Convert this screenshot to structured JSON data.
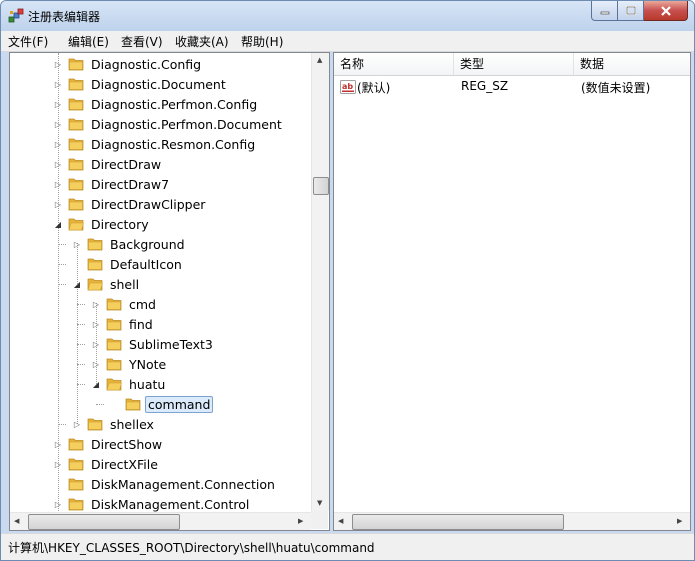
{
  "window": {
    "title": "注册表编辑器"
  },
  "menu": {
    "items": [
      "文件(F)",
      "编辑(E)",
      "查看(V)",
      "收藏夹(A)",
      "帮助(H)"
    ]
  },
  "tree": {
    "rows": [
      {
        "label": "Diagnostic.Config",
        "level": 0,
        "state": "collapsed"
      },
      {
        "label": "Diagnostic.Document",
        "level": 0,
        "state": "collapsed"
      },
      {
        "label": "Diagnostic.Perfmon.Config",
        "level": 0,
        "state": "collapsed"
      },
      {
        "label": "Diagnostic.Perfmon.Document",
        "level": 0,
        "state": "collapsed"
      },
      {
        "label": "Diagnostic.Resmon.Config",
        "level": 0,
        "state": "collapsed"
      },
      {
        "label": "DirectDraw",
        "level": 0,
        "state": "collapsed"
      },
      {
        "label": "DirectDraw7",
        "level": 0,
        "state": "collapsed"
      },
      {
        "label": "DirectDrawClipper",
        "level": 0,
        "state": "collapsed"
      },
      {
        "label": "Directory",
        "level": 0,
        "state": "expanded"
      },
      {
        "label": "Background",
        "level": 1,
        "state": "collapsed"
      },
      {
        "label": "DefaultIcon",
        "level": 1,
        "state": "leaf"
      },
      {
        "label": "shell",
        "level": 1,
        "state": "expanded"
      },
      {
        "label": "cmd",
        "level": 2,
        "state": "collapsed"
      },
      {
        "label": "find",
        "level": 2,
        "state": "collapsed"
      },
      {
        "label": "SublimeText3",
        "level": 2,
        "state": "collapsed"
      },
      {
        "label": "YNote",
        "level": 2,
        "state": "collapsed"
      },
      {
        "label": "huatu",
        "level": 2,
        "state": "expanded"
      },
      {
        "label": "command",
        "level": 3,
        "state": "leaf",
        "selected": true
      },
      {
        "label": "shellex",
        "level": 1,
        "state": "collapsed"
      },
      {
        "label": "DirectShow",
        "level": 0,
        "state": "collapsed"
      },
      {
        "label": "DirectXFile",
        "level": 0,
        "state": "collapsed"
      },
      {
        "label": "DiskManagement.Connection",
        "level": 0,
        "state": "leaf"
      },
      {
        "label": "DiskManagement.Control",
        "level": 0,
        "state": "collapsed"
      }
    ]
  },
  "list": {
    "columns": [
      "名称",
      "类型",
      "数据"
    ],
    "rows": [
      {
        "name": "(默认)",
        "type": "REG_SZ",
        "data": "(数值未设置)",
        "icon": "string-value-icon"
      }
    ]
  },
  "status": {
    "path": "计算机\\HKEY_CLASSES_ROOT\\Directory\\shell\\huatu\\command"
  },
  "colors": {
    "folder": "#f5cf5d",
    "selection": "#dcebfc",
    "selection_border": "#7da2ce",
    "close_button": "#c75050"
  }
}
